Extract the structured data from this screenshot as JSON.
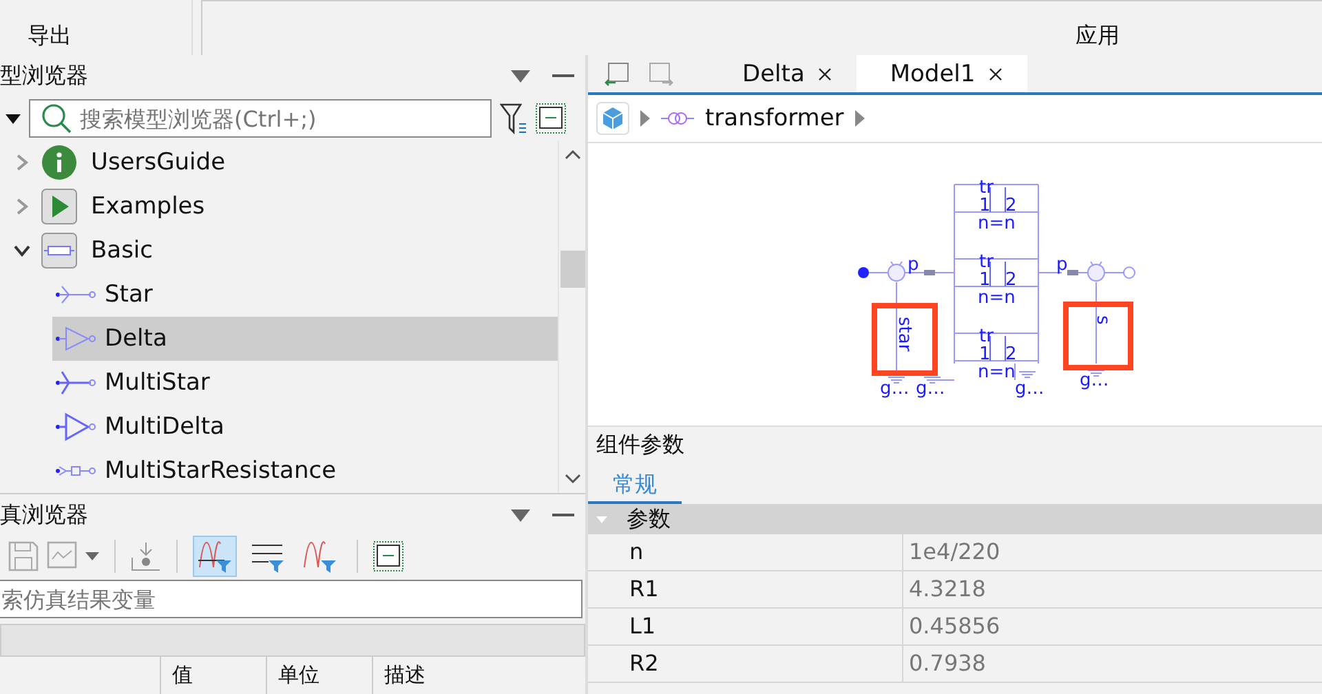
{
  "toolbar": {
    "left_label": "导出",
    "right_label": "应用"
  },
  "model_browser": {
    "title": "型浏览器",
    "search": {
      "placeholder": "搜索模型浏览器(Ctrl+;)"
    },
    "tree": [
      {
        "label": "UsersGuide",
        "kind": "info",
        "expanded": false
      },
      {
        "label": "Examples",
        "kind": "examples",
        "expanded": false
      },
      {
        "label": "Basic",
        "kind": "package",
        "expanded": true,
        "children": [
          {
            "label": "Star",
            "kind": "star",
            "selected": false
          },
          {
            "label": "Delta",
            "kind": "delta",
            "selected": true
          },
          {
            "label": "MultiStar",
            "kind": "multistar",
            "selected": false
          },
          {
            "label": "MultiDelta",
            "kind": "multidelta",
            "selected": false
          },
          {
            "label": "MultiStarResistance",
            "kind": "resistor",
            "selected": false
          }
        ]
      }
    ]
  },
  "simulation_browser": {
    "title": "真浏览器",
    "filters": [
      {
        "selected": true
      },
      {
        "selected": false
      },
      {
        "selected": false
      }
    ],
    "search": {
      "placeholder": "索仿真结果变量"
    },
    "columns": [
      "值",
      "单位",
      "描述"
    ]
  },
  "editor": {
    "tabs": [
      {
        "label": "Delta",
        "selected": false
      },
      {
        "label": "Model1",
        "selected": true
      }
    ],
    "breadcrumb": "transformer",
    "diagram": {
      "transformers": [
        {
          "name": "tr",
          "primary": "1",
          "secondary": "2",
          "ratio": "n=n"
        },
        {
          "name": "tr",
          "primary": "1",
          "secondary": "2",
          "ratio": "n=n"
        },
        {
          "name": "tr",
          "primary": "1",
          "secondary": "2",
          "ratio": "n=n"
        }
      ],
      "ports": [
        "p",
        "p"
      ],
      "components": [
        {
          "label": "star",
          "highlighted": true
        },
        {
          "label": "s",
          "highlighted": true
        }
      ],
      "grounds": [
        "g…",
        "g…",
        "g…",
        "g…"
      ]
    }
  },
  "parameters": {
    "title": "组件参数",
    "tabs": [
      {
        "label": "常规",
        "selected": true
      }
    ],
    "group": "参数",
    "rows": [
      {
        "name": "n",
        "value": "1e4/220"
      },
      {
        "name": "R1",
        "value": "4.3218"
      },
      {
        "name": "L1",
        "value": "0.45856"
      },
      {
        "name": "R2",
        "value": "0.7938"
      }
    ]
  }
}
